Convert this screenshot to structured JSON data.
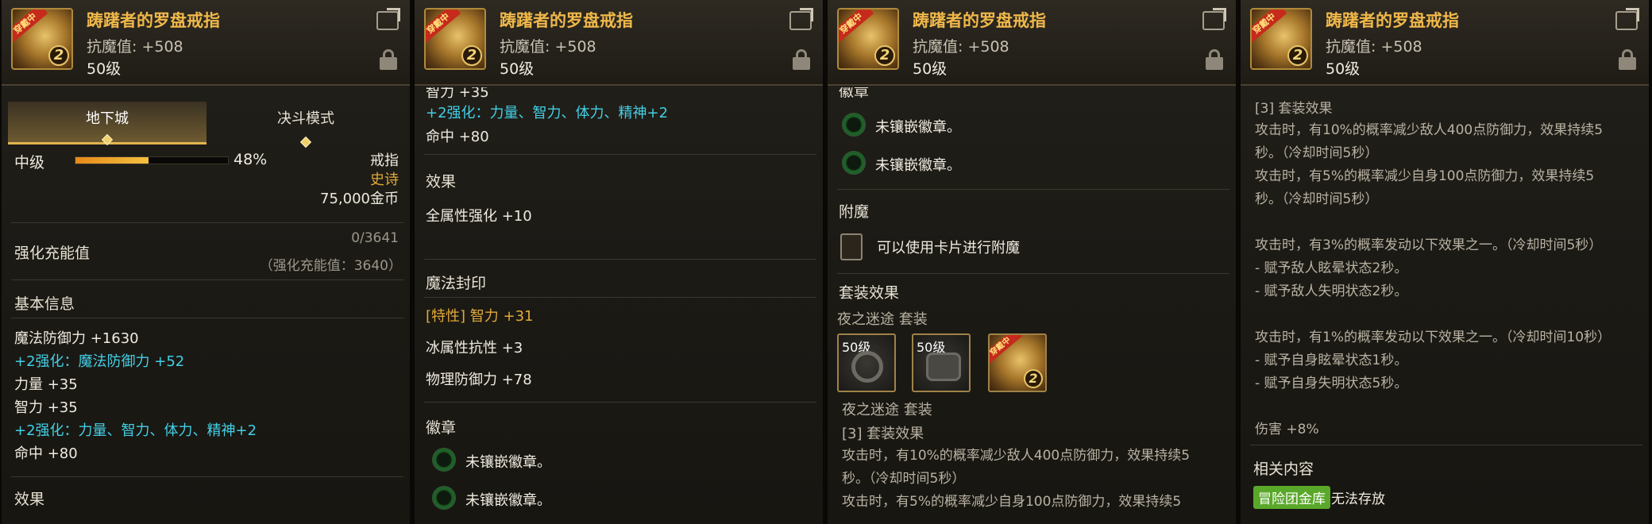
{
  "item": {
    "title": "踌躇者的罗盘戒指",
    "resist": "抗魔值: +508",
    "level": "50级",
    "lock_band": "穿戴中",
    "badge": "2"
  },
  "panel1": {
    "tabs": [
      "地下城",
      "决斗模式"
    ],
    "grade": "中级",
    "percent": "48%",
    "progress": 0.48,
    "type": "戒指",
    "rarity": "史诗",
    "price": "75,000金币",
    "charge_label": "强化充能值",
    "charge_value": "0/3641",
    "charge_note": "（强化充能值：3640）",
    "basic_title": "基本信息",
    "stats": [
      {
        "text": "魔法防御力 +1630",
        "color": "white"
      },
      {
        "text": "+2强化：魔法防御力 +52",
        "color": "cyan"
      },
      {
        "text": "力量 +35",
        "color": "white"
      },
      {
        "text": "智力 +35",
        "color": "white"
      },
      {
        "text": "+2强化：力量、智力、体力、精神+2",
        "color": "cyan"
      },
      {
        "text": "命中 +80",
        "color": "white"
      }
    ],
    "effect_title": "效果"
  },
  "panel2": {
    "top_cut": "智力 +35",
    "enhance": "+2强化：力量、智力、体力、精神+2",
    "hit": "命中 +80",
    "effect_title": "效果",
    "effect_text": "全属性强化 +10",
    "seal_title": "魔法封印",
    "seal_1": "[特性] 智力 +31",
    "seal_2": "冰属性抗性 +3",
    "seal_3": "物理防御力 +78",
    "emblem_title": "徽章",
    "emblem_1": "未镶嵌徽章。",
    "emblem_2": "未镶嵌徽章。"
  },
  "panel3": {
    "top_cut": "徽章",
    "emblem_1": "未镶嵌徽章。",
    "emblem_2": "未镶嵌徽章。",
    "enchant_title": "附魔",
    "enchant_text": "可以使用卡片进行附魔",
    "set_title": "套装效果",
    "set_name": "夜之迷途  套装",
    "set_levels": [
      "50级",
      "50级"
    ],
    "set_name2": "夜之迷途  套装",
    "set3": "[3] 套装效果",
    "lines": [
      "攻击时，有10%的概率减少敌人400点防御力，效果持续5",
      "秒。（冷却时间5秒）",
      "攻击时，有5%的概率减少自身100点防御力，效果持续5"
    ]
  },
  "panel4": {
    "set3": "[3] 套装效果",
    "lines": [
      "攻击时，有10%的概率减少敌人400点防御力，效果持续5",
      "秒。（冷却时间5秒）",
      "攻击时，有5%的概率减少自身100点防御力，效果持续5",
      "秒。（冷却时间5秒）",
      "",
      "攻击时，有3%的概率发动以下效果之一。（冷却时间5秒）",
      "- 赋予敌人眩晕状态2秒。",
      "- 赋予敌人失明状态2秒。",
      "",
      "攻击时，有1%的概率发动以下效果之一。（冷却时间10秒）",
      "- 赋予自身眩晕状态1秒。",
      "- 赋予自身失明状态5秒。",
      "",
      "伤害 +8%"
    ],
    "related_title": "相关内容",
    "guild_tag": "冒险团金库",
    "guild_note": "无法存放"
  }
}
